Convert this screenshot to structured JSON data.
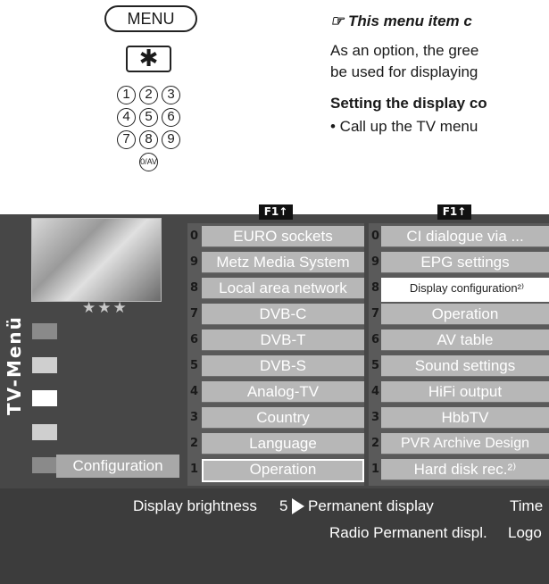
{
  "remote": {
    "menu_label": "MENU",
    "star_label": "✱",
    "digits": [
      "1",
      "2",
      "3",
      "4",
      "5",
      "6",
      "7",
      "8",
      "9"
    ],
    "zero_label": "0/AV"
  },
  "text": {
    "note": "☞ This menu item c",
    "para_line1": "As an option, the gree",
    "para_line2": "be used for displaying",
    "subheading": "Setting the display co",
    "bullet": "• Call up the TV menu"
  },
  "osd": {
    "f1_label": "F1↑",
    "side_title": "TV-Menü",
    "stars": "★★★",
    "breadcrumb": "Configuration",
    "column_left": [
      {
        "num": "0",
        "label": "EURO sockets"
      },
      {
        "num": "9",
        "label": "Metz Media System"
      },
      {
        "num": "8",
        "label": "Local area network"
      },
      {
        "num": "7",
        "label": "DVB-C"
      },
      {
        "num": "6",
        "label": "DVB-T"
      },
      {
        "num": "5",
        "label": "DVB-S"
      },
      {
        "num": "4",
        "label": "Analog-TV"
      },
      {
        "num": "3",
        "label": "Country"
      },
      {
        "num": "2",
        "label": "Language"
      },
      {
        "num": "1",
        "label": "Operation"
      }
    ],
    "column_right": [
      {
        "num": "0",
        "label": "CI dialogue via ..."
      },
      {
        "num": "9",
        "label": "EPG settings"
      },
      {
        "num": "8",
        "label": "Display configuration²⁾"
      },
      {
        "num": "7",
        "label": "Operation"
      },
      {
        "num": "6",
        "label": "AV table"
      },
      {
        "num": "5",
        "label": "Sound settings"
      },
      {
        "num": "4",
        "label": "HiFi output"
      },
      {
        "num": "3",
        "label": "HbbTV"
      },
      {
        "num": "2",
        "label": "PVR Archive Design"
      },
      {
        "num": "1",
        "label": "Hard disk rec.²⁾"
      }
    ],
    "bottom": {
      "brightness_label": "Display brightness",
      "brightness_value": "5",
      "permanent_display": "Permanent display",
      "time": "Time",
      "radio_permanent": "Radio Permanent displ.",
      "logo": "Logo"
    }
  }
}
